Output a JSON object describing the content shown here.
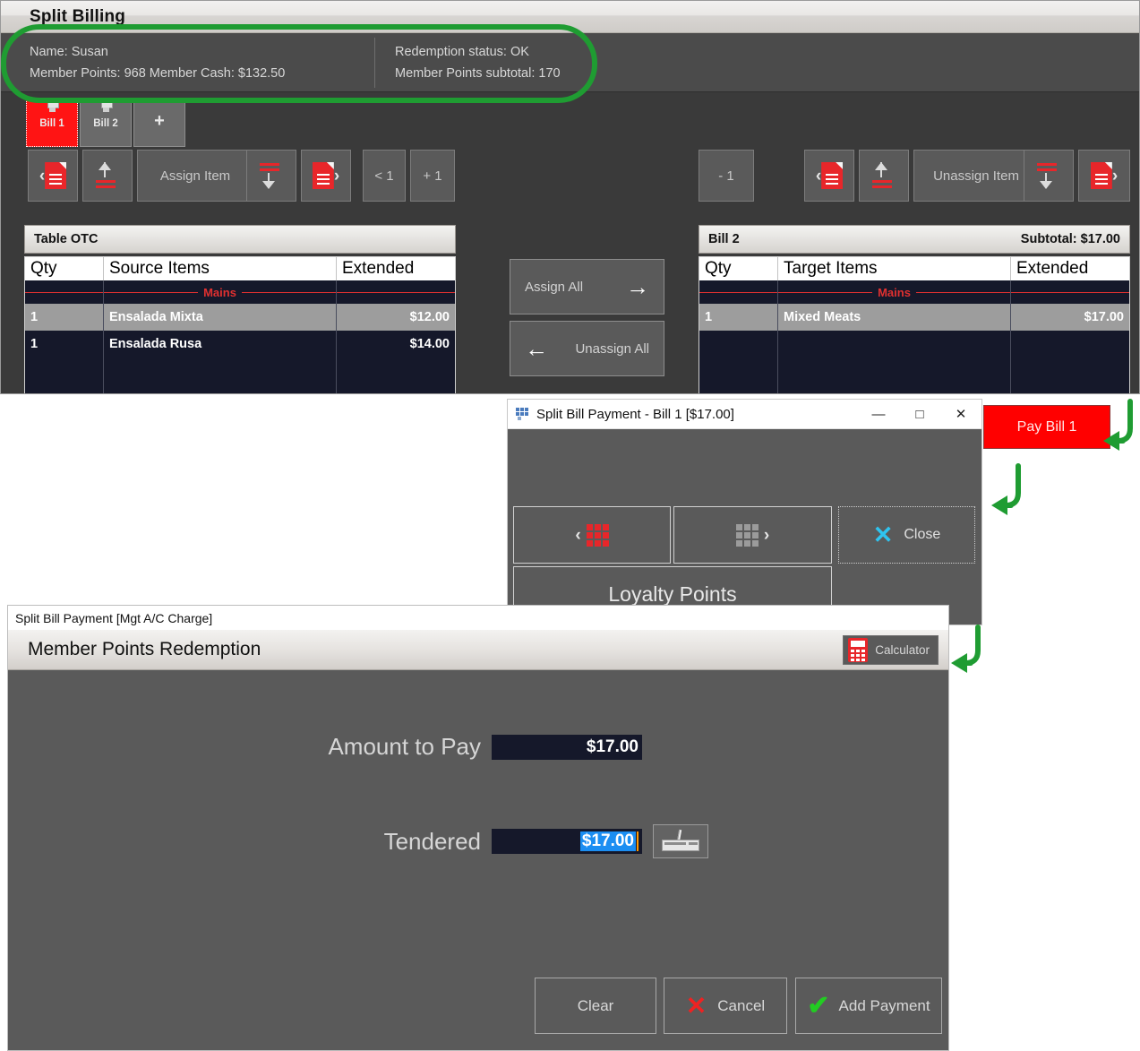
{
  "main_window": {
    "title": "Split Billing",
    "member": {
      "name_line": "Name: Susan",
      "points_line": "Member Points: 968 Member Cash: $132.50",
      "status_line": "Redemption status: OK",
      "subtotal_line": "Member Points subtotal: 170"
    },
    "bill_tabs": [
      {
        "label": "Bill 1",
        "active": true
      },
      {
        "label": "Bill 2",
        "active": false
      },
      {
        "label": "+",
        "active": false
      }
    ],
    "left_toolbar": {
      "prev_doc_icon": "document-prev-icon",
      "move_up_icon": "move-up-icon",
      "assign_item_label": "Assign Item",
      "move_down_icon": "move-down-icon",
      "next_doc_icon": "document-next-icon",
      "qty_dec_label": "< 1",
      "qty_inc_label": "+ 1"
    },
    "right_toolbar": {
      "minus_one_label": "- 1",
      "prev_doc_icon": "document-prev-icon",
      "move_up_icon": "move-up-icon",
      "unassign_item_label": "Unassign Item",
      "move_down_icon": "move-down-icon",
      "next_doc_icon": "document-next-icon"
    },
    "source_panel": {
      "header": "Table OTC",
      "columns": [
        "Qty",
        "Source Items",
        "Extended"
      ],
      "group_label": "Mains",
      "rows": [
        {
          "qty": "1",
          "item": "Ensalada Mixta",
          "extended": "$12.00",
          "selected": true
        },
        {
          "qty": "1",
          "item": "Ensalada Rusa",
          "extended": "$14.00",
          "selected": false
        }
      ]
    },
    "target_panel": {
      "header": "Bill 2",
      "subtotal": "Subtotal: $17.00",
      "columns": [
        "Qty",
        "Target Items",
        "Extended"
      ],
      "group_label": "Mains",
      "rows": [
        {
          "qty": "1",
          "item": "Mixed Meats",
          "extended": "$17.00",
          "selected": true
        }
      ]
    },
    "center_buttons": {
      "assign_all_label": "Assign All",
      "assign_all_icon": "arrow-right-icon",
      "unassign_all_label": "Unassign All",
      "unassign_all_icon": "arrow-left-icon"
    }
  },
  "pay_dialog": {
    "title": "Split Bill Payment - Bill 1  [$17.00]",
    "app_icon": "windows-app-icon",
    "minimize_label": "—",
    "maximize_label": "□",
    "close_label": "✕",
    "buttons": {
      "prev_page_icon": "keypad-prev-icon",
      "next_page_icon": "keypad-next-icon",
      "close_label": "Close",
      "close_icon": "close-x-icon",
      "loyalty_points_label": "Loyalty Points"
    }
  },
  "redemption_window": {
    "titlebar": "Split Bill Payment  [Mgt A/C Charge]",
    "header_title": "Member Points Redemption",
    "calculator_label": "Calculator",
    "calculator_icon": "calculator-icon",
    "fields": [
      {
        "label": "Amount to Pay",
        "value": "$17.00",
        "selected": false
      },
      {
        "label": "Tendered",
        "value": "$17.00",
        "selected": true
      }
    ],
    "keyboard_icon": "keyboard-icon",
    "footer_buttons": [
      {
        "label": "Clear",
        "icon": ""
      },
      {
        "label": "Cancel",
        "icon": "red-x-icon"
      },
      {
        "label": "Add Payment",
        "icon": "green-check-icon"
      }
    ]
  },
  "annotations": {
    "pay_bill_chip": "Pay Bill 1",
    "highlight_color": "#1f9c32",
    "arrow_count": 3,
    "highlight_target": "member-info-panel"
  }
}
